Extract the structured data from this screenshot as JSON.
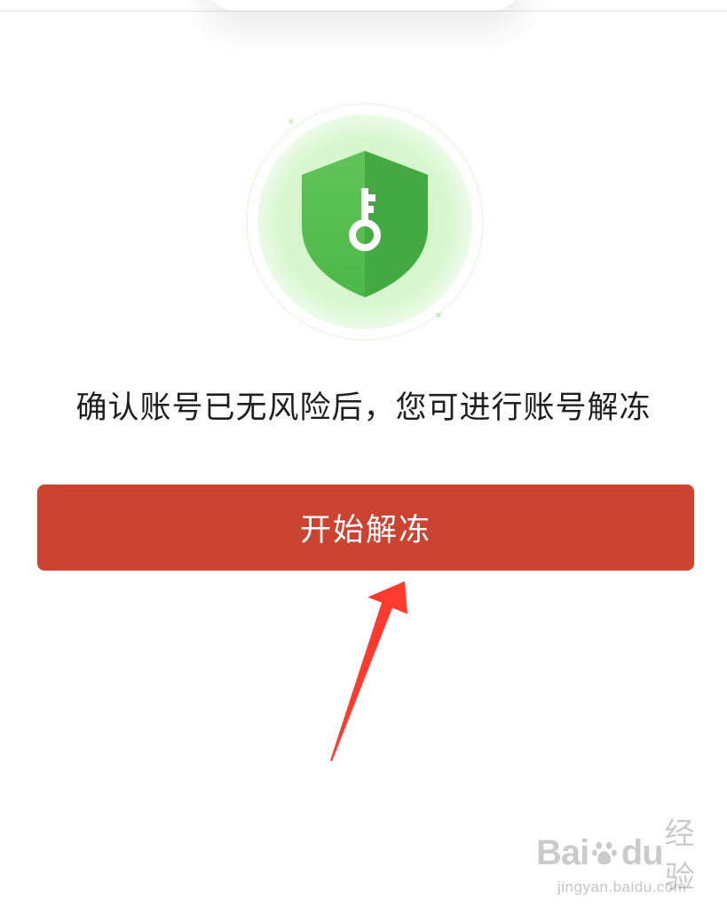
{
  "message": "确认账号已无风险后，您可进行账号解冻",
  "button": {
    "label": "开始解冻"
  },
  "icons": {
    "shield": "shield-key-icon",
    "arrow": "pointer-arrow-icon"
  },
  "colors": {
    "button_bg": "#cd4332",
    "shield_green": "#4cb84a",
    "halo_green": "#dcf7d4",
    "arrow_red": "#ff3b2f"
  },
  "watermark": {
    "brand_left": "Bai",
    "brand_right": "du",
    "suffix": "经验",
    "url": "jingyan.baidu.com"
  }
}
